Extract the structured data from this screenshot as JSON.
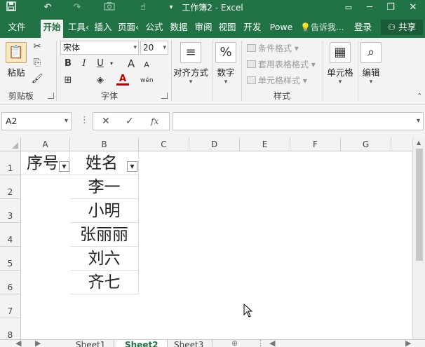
{
  "window": {
    "title": "工作簿2 - Excel",
    "save_icon": "save-icon",
    "undo_icon": "undo-icon",
    "redo_icon": "redo-icon",
    "camera_icon": "camera-icon",
    "touch_icon": "touch-mode-icon",
    "customize_icon": "customize-quick-access-icon",
    "minimize_label": "─",
    "restore_label": "❐",
    "close_label": "✕",
    "ribbon_display_label": "▭"
  },
  "ribbon_tabs": [
    {
      "label": "文件",
      "active": false
    },
    {
      "label": "开始",
      "active": true
    },
    {
      "label": "工具‹",
      "active": false
    },
    {
      "label": "插入",
      "active": false
    },
    {
      "label": "页面‹",
      "active": false
    },
    {
      "label": "公式",
      "active": false
    },
    {
      "label": "数据",
      "active": false
    },
    {
      "label": "审阅",
      "active": false
    },
    {
      "label": "视图",
      "active": false
    },
    {
      "label": "开发 ",
      "active": false
    },
    {
      "label": "Powe",
      "active": false
    }
  ],
  "tell_me": "告诉我...",
  "login": "登录",
  "share": "共享",
  "ribbon": {
    "clipboard": {
      "paste_label": "粘贴",
      "group_label": "剪贴板"
    },
    "font": {
      "font_name": "宋体",
      "font_size": "20",
      "group_label": "字体",
      "bold": "B",
      "italic": "I",
      "underline": "U",
      "font_color_letter": "A",
      "grow": "A",
      "shrink": "A",
      "wen": "wén"
    },
    "alignment": {
      "label": "对齐方式"
    },
    "number": {
      "label": "数字",
      "symbol": "%"
    },
    "styles": {
      "conditional": "条件格式",
      "table_format": "套用表格格式",
      "cell_style": "单元格样式",
      "group_label": "样式"
    },
    "cells": {
      "label": "单元格"
    },
    "editing": {
      "label": "编辑"
    }
  },
  "formula_bar": {
    "name_box": "A2",
    "cancel": "✕",
    "enter": "✓",
    "fx": "fx",
    "content": ""
  },
  "columns": [
    "A",
    "B",
    "C",
    "D",
    "E",
    "F",
    "G"
  ],
  "rows": [
    "1",
    "2",
    "3",
    "4",
    "5",
    "6",
    "7",
    "8"
  ],
  "cells": {
    "A1": "序号",
    "B1": "姓名",
    "B2": "李一",
    "B3": "小明",
    "B4": "张丽丽",
    "B5": "刘六",
    "B6": "齐七"
  },
  "sheet_tabs": [
    {
      "label": "Sheet1",
      "active": false
    },
    {
      "label": "Sheet2",
      "active": true
    },
    {
      "label": "Sheet3",
      "active": false
    }
  ],
  "accent_color": "#217346"
}
